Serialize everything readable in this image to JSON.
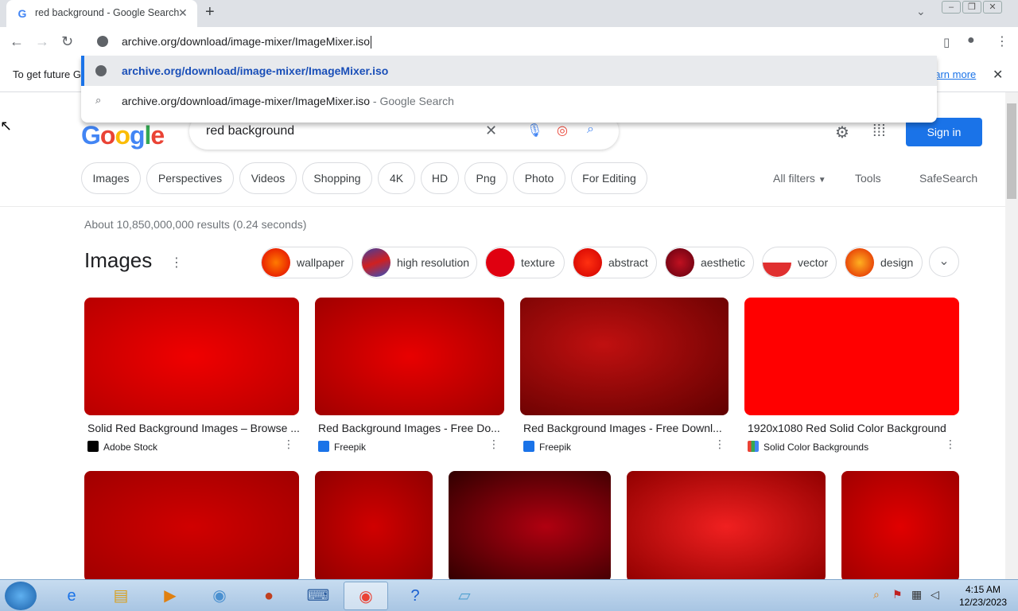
{
  "browser": {
    "tab_title": "red background - Google Search",
    "tab_favicon": "G",
    "omnibox_text": "archive.org/download/image-mixer/ImageMixer.iso",
    "suggestions": [
      {
        "text": "archive.org/download/image-mixer/ImageMixer.iso",
        "icon": "globe-icon",
        "suffix": ""
      },
      {
        "text": "archive.org/download/image-mixer/ImageMixer.iso",
        "icon": "search-icon",
        "suffix": " - Google Search"
      }
    ]
  },
  "infobar": {
    "text": "To get future G",
    "link": "earn more"
  },
  "search": {
    "query": "red background",
    "sign_in": "Sign in",
    "logo_text": "Google"
  },
  "chips": [
    "Images",
    "Perspectives",
    "Videos",
    "Shopping",
    "4K",
    "HD",
    "Png",
    "Photo",
    "For Editing"
  ],
  "filters": {
    "all_filters": "All filters",
    "tools": "Tools",
    "safesearch": "SafeSearch"
  },
  "results_stats": "About 10,850,000,000 results (0.24 seconds)",
  "images_heading": "Images",
  "related": [
    "wallpaper",
    "high resolution",
    "texture",
    "abstract",
    "aesthetic",
    "vector",
    "design"
  ],
  "cards_row1": [
    {
      "title": "Solid Red Background Images – Browse ...",
      "source": "Adobe Stock"
    },
    {
      "title": "Red Background Images - Free Do...",
      "source": "Freepik"
    },
    {
      "title": "Red Background Images - Free Downl...",
      "source": "Freepik"
    },
    {
      "title": "1920x1080 Red Solid Color Background",
      "source": "Solid Color Backgrounds"
    }
  ],
  "taskbar": {
    "time": "4:15 AM",
    "date": "12/23/2023"
  },
  "colors": {
    "accent": "#1a73e8",
    "red": "#e00000"
  }
}
